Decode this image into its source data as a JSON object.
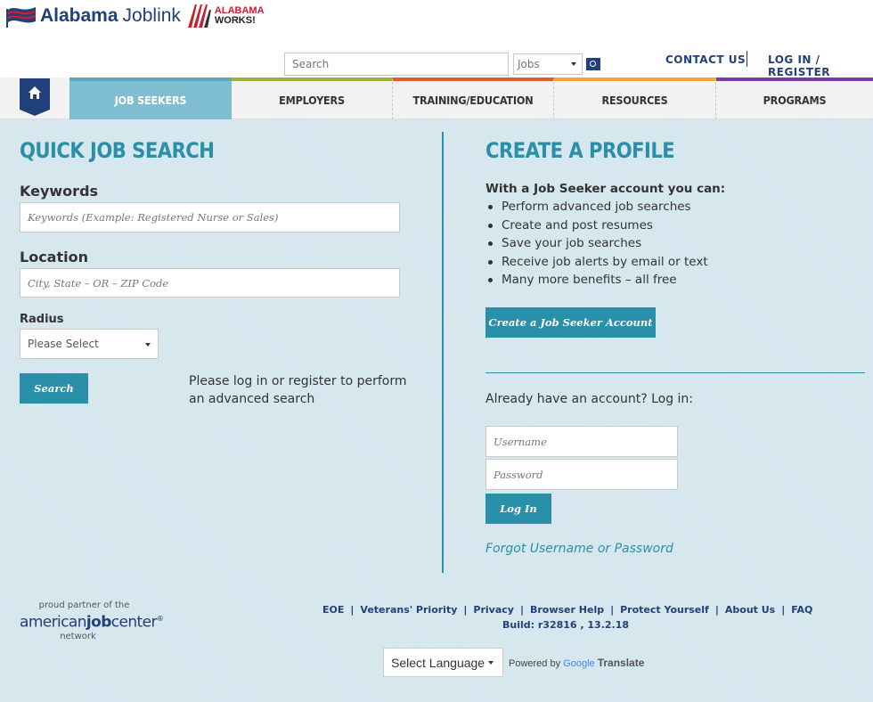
{
  "header": {
    "brand_bold": "Alabama",
    "brand_light": "Joblink",
    "aw_line1": "ALABAMA",
    "aw_line2": "WORKS!",
    "search_placeholder": "Search",
    "search_type": "Jobs",
    "contact_label": "CONTACT US",
    "login_label": "LOG IN / REGISTER"
  },
  "nav": {
    "tabs": [
      {
        "label": "JOB SEEKERS",
        "color": "#7fbdd0"
      },
      {
        "label": "EMPLOYERS",
        "color": "#9ab53a"
      },
      {
        "label": "TRAINING/EDUCATION",
        "color": "#e05a3c"
      },
      {
        "label": "RESOURCES",
        "color": "#f0a830"
      },
      {
        "label": "PROGRAMS",
        "color": "#7b3c9c"
      }
    ]
  },
  "quick_search": {
    "title": "QUICK JOB SEARCH",
    "keywords_label": "Keywords",
    "keywords_placeholder": "Keywords (Example: Registered Nurse or Sales)",
    "location_label": "Location",
    "location_placeholder": "City, State – OR – ZIP Code",
    "radius_label": "Radius",
    "radius_value": "Please Select",
    "search_button": "Search",
    "advanced_note": "Please log in or register to perform an advanced search"
  },
  "profile": {
    "title": "CREATE A PROFILE",
    "intro": "With a Job Seeker account you can:",
    "benefits": [
      "Perform advanced job searches",
      "Create and post resumes",
      "Save your job searches",
      "Receive job alerts by email or text",
      "Many more benefits – all free"
    ],
    "create_button": "Create a Job Seeker Account",
    "login_prompt": "Already have an account? Log in:",
    "username_placeholder": "Username",
    "password_placeholder": "Password",
    "login_button": "Log In",
    "forgot_link": "Forgot Username or Password"
  },
  "footer": {
    "partner_line1": "proud partner of the",
    "partner_a": "american",
    "partner_b": "job",
    "partner_c": "center",
    "partner_reg": "®",
    "partner_line3": "network",
    "links": [
      "EOE",
      "Veterans' Priority",
      "Privacy",
      "Browser Help",
      "Protect Yourself",
      "About Us",
      "FAQ"
    ],
    "build": "Build: r32816 , 13.2.18",
    "language_label": "Select Language",
    "powered_by": "Powered by",
    "google": "Google",
    "translate": "Translate"
  },
  "colors": {
    "brand_navy": "#22407a",
    "teal": "#2a8fa8",
    "background": "#d4e6ed"
  }
}
